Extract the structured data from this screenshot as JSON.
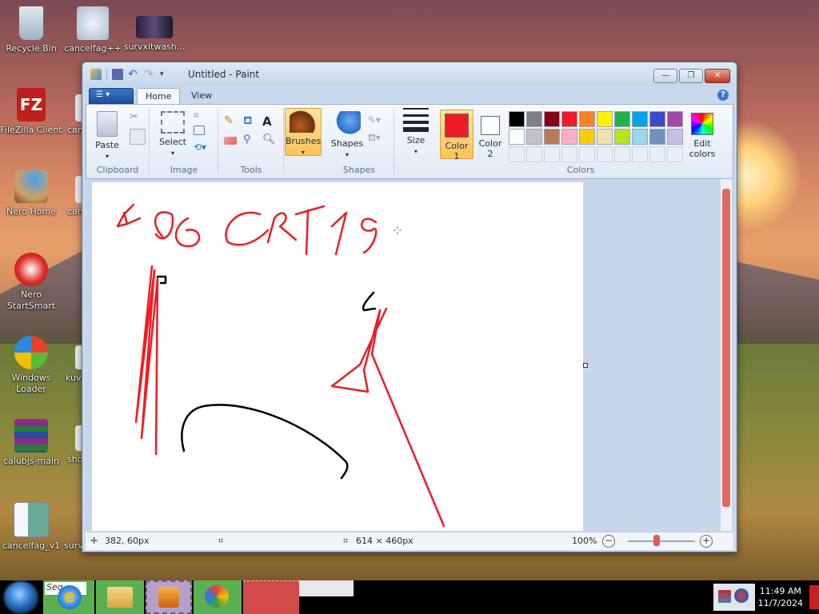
{
  "desktop": {
    "icons": [
      {
        "label": "Recycle Bin"
      },
      {
        "label": "cancelfag++"
      },
      {
        "label": "survxitwash..."
      },
      {
        "label": "FileZilla Client"
      },
      {
        "label": "can"
      },
      {
        "label": "Nero Home"
      },
      {
        "label": "can"
      },
      {
        "label": "Nero StartSmart"
      },
      {
        "label": "Windows Loader"
      },
      {
        "label": "kuv"
      },
      {
        "label": "calubjs-main"
      },
      {
        "label": "sho"
      },
      {
        "label": "cancelfag_v1"
      },
      {
        "label": "surv"
      }
    ]
  },
  "window": {
    "title": "Untitled - Paint",
    "tabs": [
      {
        "label": "Home"
      },
      {
        "label": "View"
      }
    ],
    "help": "?"
  },
  "ribbon": {
    "groups": [
      {
        "label": "Clipboard"
      },
      {
        "label": "Image"
      },
      {
        "label": "Tools"
      },
      {
        "label": "Shapes"
      },
      {
        "label": "Colors"
      }
    ],
    "buttons": {
      "paste": "Paste",
      "select": "Select",
      "brushes": "Brushes",
      "shapes": "Shapes",
      "size": "Size",
      "color1_line1": "Color",
      "color1_line2": "1",
      "color2_line1": "Color",
      "color2_line2": "2",
      "edit_colors_line1": "Edit",
      "edit_colors_line2": "colors"
    },
    "color1": "#ed1c24",
    "color2": "#ffffff",
    "palette_row1": [
      "#000000",
      "#7f7f7f",
      "#880015",
      "#ed1c24",
      "#ff7f27",
      "#fff200",
      "#22b14c",
      "#00a2e8",
      "#3f48cc",
      "#a349a4"
    ],
    "palette_row2": [
      "#ffffff",
      "#c3c3c3",
      "#b97a57",
      "#ffaec9",
      "#ffc90e",
      "#efe4b0",
      "#b5e61d",
      "#99d9ea",
      "#7092be",
      "#c8bfe7"
    ]
  },
  "canvas": {
    "text_scrawl": "R06 ERT19"
  },
  "status": {
    "cursor_pos": "382, 60px",
    "image_size": "614 × 460px",
    "zoom": "100%"
  },
  "taskbar": {
    "search_text": "Seq",
    "time": "11:49 AM",
    "date": "11/7/2024"
  }
}
